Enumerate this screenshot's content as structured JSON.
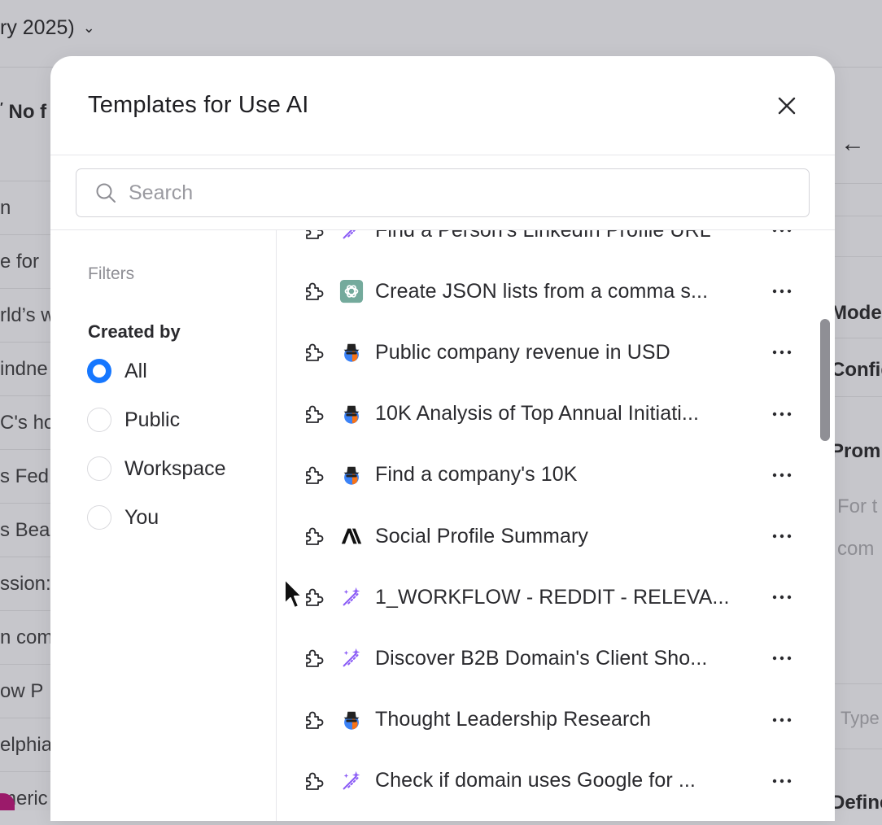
{
  "background": {
    "top_title": "ry 2025)",
    "left_header": "No f",
    "left_rows": [
      "n",
      "e for",
      "rld’s w",
      "indne",
      "C's ho",
      "s Fed",
      "s Bea",
      "ssion:",
      "n com",
      "ow P",
      "elphia",
      "meric"
    ],
    "right_panel": {
      "labels": [
        "Mode",
        "Config",
        "Promp"
      ],
      "placeholder_lines": [
        "For t",
        "com"
      ],
      "type_text": "Type",
      "bottom_label": "Define"
    }
  },
  "modal": {
    "title": "Templates for Use AI",
    "search": {
      "placeholder": "Search",
      "value": ""
    },
    "filters": {
      "heading": "Filters",
      "created_by_label": "Created by",
      "options": [
        {
          "label": "All",
          "checked": true
        },
        {
          "label": "Public",
          "checked": false
        },
        {
          "label": "Workspace",
          "checked": false
        },
        {
          "label": "You",
          "checked": false
        }
      ]
    },
    "templates": [
      {
        "name": "Find a Person's LinkedIn Profile URL",
        "model_icon": "wand-icon"
      },
      {
        "name": "Create JSON lists from a comma s...",
        "model_icon": "openai-icon"
      },
      {
        "name": "Public company revenue in USD",
        "model_icon": "agent-icon"
      },
      {
        "name": "10K Analysis of Top Annual Initiati...",
        "model_icon": "agent-icon"
      },
      {
        "name": "Find a company's 10K",
        "model_icon": "agent-icon"
      },
      {
        "name": "Social Profile Summary",
        "model_icon": "anthropic-icon"
      },
      {
        "name": "1_WORKFLOW - REDDIT - RELEVA...",
        "model_icon": "wand-icon"
      },
      {
        "name": "Discover B2B Domain's Client Sho...",
        "model_icon": "wand-icon"
      },
      {
        "name": "Thought Leadership Research",
        "model_icon": "agent-icon"
      },
      {
        "name": "Check if domain uses Google for ...",
        "model_icon": "wand-icon"
      }
    ]
  },
  "colors": {
    "accent": "#1677ff",
    "wand": "#8b5cf6",
    "openai_bg": "#74aa9c"
  }
}
